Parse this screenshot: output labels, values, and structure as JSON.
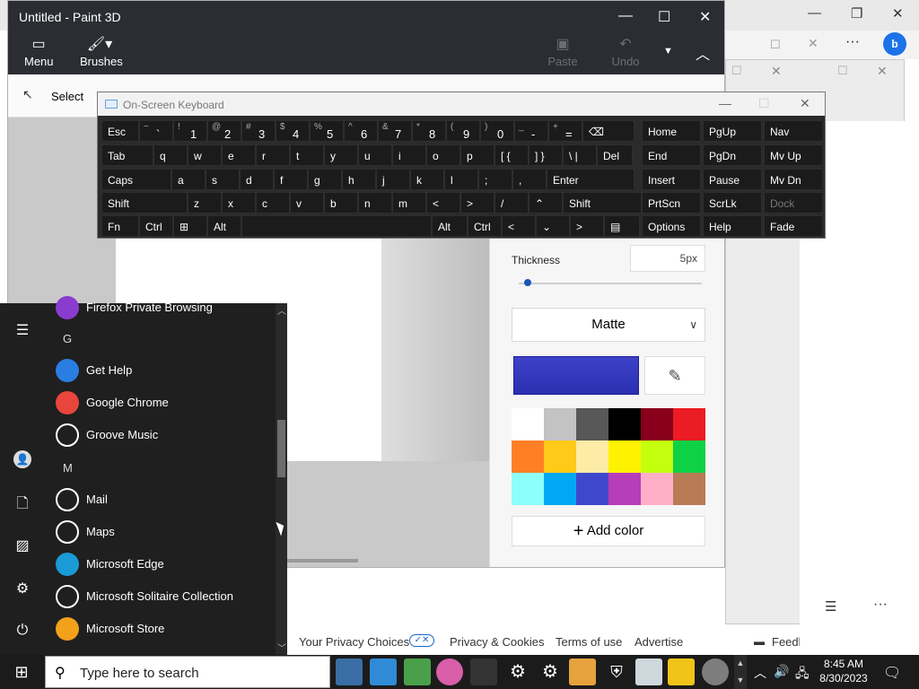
{
  "browser": {
    "footer_links": [
      "Your Privacy Choices",
      "Privacy & Cookies",
      "Terms of use",
      "Advertise"
    ],
    "feedback": "Feedback",
    "more": "..."
  },
  "paint": {
    "title": "Untitled - Paint 3D",
    "menu_label": "Menu",
    "brushes_label": "Brushes",
    "paste_label": "Paste",
    "undo_label": "Undo",
    "select_label": "Select",
    "thickness_label": "Thickness",
    "thickness_value": "5px",
    "thickness_level": 0.05,
    "finish_value": "Matte",
    "add_color": "Add color",
    "current_color": "#3d42c8",
    "palette": [
      "#ffffff",
      "#c3c3c3",
      "#585858",
      "#000000",
      "#88001b",
      "#ec1c24",
      "#ff7f27",
      "#ffca18",
      "#fdeca6",
      "#fff200",
      "#c4ff0e",
      "#0ed145",
      "#8cfffb",
      "#00a8f3",
      "#3f48cc",
      "#b83dba",
      "#ffaec8",
      "#b97a56"
    ]
  },
  "osk": {
    "title": "On-Screen Keyboard",
    "row1": [
      {
        "t": "Esc"
      },
      {
        "s": "~",
        "m": "`"
      },
      {
        "s": "!",
        "m": "1"
      },
      {
        "s": "@",
        "m": "2"
      },
      {
        "s": "#",
        "m": "3"
      },
      {
        "s": "$",
        "m": "4"
      },
      {
        "s": "%",
        "m": "5"
      },
      {
        "s": "^",
        "m": "6"
      },
      {
        "s": "&",
        "m": "7"
      },
      {
        "s": "*",
        "m": "8"
      },
      {
        "s": "(",
        "m": "9"
      },
      {
        "s": ")",
        "m": "0"
      },
      {
        "s": "_",
        "m": "-"
      },
      {
        "s": "+",
        "m": "="
      },
      {
        "t": "⌫"
      }
    ],
    "row2": [
      "Tab",
      "q",
      "w",
      "e",
      "r",
      "t",
      "y",
      "u",
      "i",
      "o",
      "p",
      "[ {",
      "] }",
      "\\ |",
      "Del"
    ],
    "row3": [
      "Caps",
      "a",
      "s",
      "d",
      "f",
      "g",
      "h",
      "j",
      "k",
      "l",
      ";",
      ",",
      "Enter"
    ],
    "row4": [
      "Shift",
      "z",
      "x",
      "c",
      "v",
      "b",
      "n",
      "m",
      "<",
      ">",
      "/",
      "⌃",
      "Shift"
    ],
    "row5": [
      "Fn",
      "Ctrl",
      "⊞",
      "Alt",
      "",
      "Alt",
      "Ctrl",
      "<",
      "⌄",
      ">",
      "▤"
    ],
    "nav": [
      [
        "Home",
        "PgUp",
        "Nav"
      ],
      [
        "End",
        "PgDn",
        "Mv Up"
      ],
      [
        "Insert",
        "Pause",
        "Mv Dn"
      ],
      [
        "PrtScn",
        "ScrLk",
        "Dock"
      ],
      [
        "Options",
        "Help",
        "Fade"
      ]
    ]
  },
  "start": {
    "top_item": "Firefox Private Browsing",
    "letter_g": "G",
    "letter_m": "M",
    "apps": [
      {
        "name": "Get Help",
        "color": "#2a7de1"
      },
      {
        "name": "Google Chrome",
        "color": "#e8453c"
      },
      {
        "name": "Groove Music",
        "color": "#ffffff"
      },
      {
        "name": "Mail",
        "color": "#ffffff"
      },
      {
        "name": "Maps",
        "color": "#ffffff"
      },
      {
        "name": "Microsoft Edge",
        "color": "#1a9ad6"
      },
      {
        "name": "Microsoft Solitaire Collection",
        "color": "#ffffff"
      },
      {
        "name": "Microsoft Store",
        "color": "#f3a01b"
      }
    ]
  },
  "taskbar": {
    "search_placeholder": "Type here to search",
    "time": "8:45 AM",
    "date": "8/30/2023"
  }
}
